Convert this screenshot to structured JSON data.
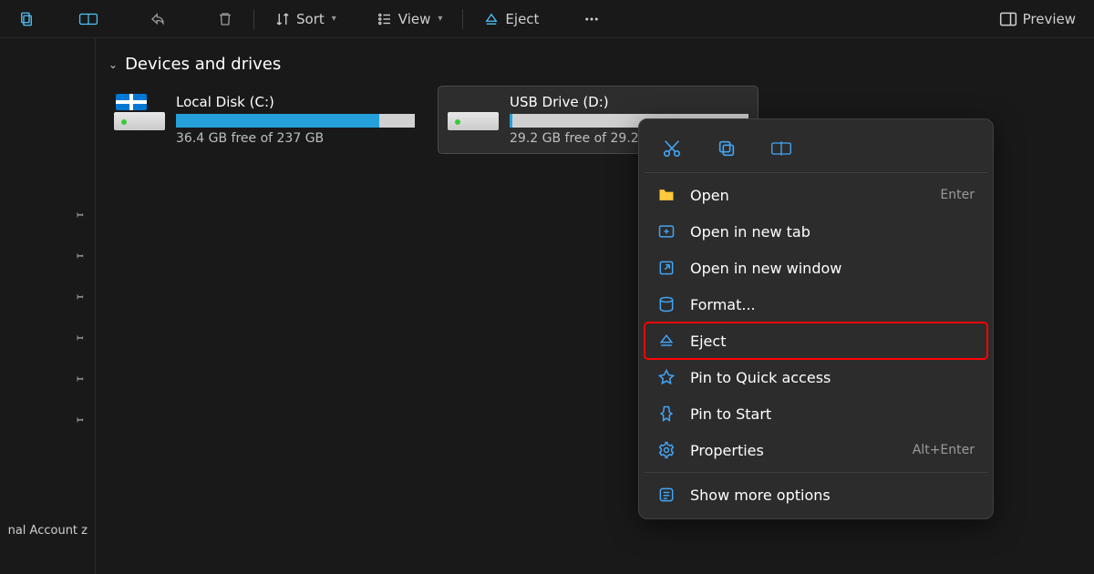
{
  "toolbar": {
    "sort_label": "Sort",
    "view_label": "View",
    "eject_label": "Eject",
    "preview_label": "Preview"
  },
  "section_header": "Devices and drives",
  "drives": [
    {
      "title": "Local Disk (C:)",
      "sub": "36.4 GB free of 237 GB",
      "use_pct": 85,
      "selected": false,
      "icon": "local"
    },
    {
      "title": "USB Drive (D:)",
      "sub": "29.2 GB free of 29.2",
      "use_pct": 1,
      "selected": true,
      "icon": "usb"
    }
  ],
  "context_menu": {
    "open": "Open",
    "open_shortcut": "Enter",
    "open_tab": "Open in new tab",
    "open_win": "Open in new window",
    "format": "Format...",
    "eject": "Eject",
    "pin_quick": "Pin to Quick access",
    "pin_start": "Pin to Start",
    "properties": "Properties",
    "properties_shortcut": "Alt+Enter",
    "more": "Show more options"
  },
  "sidebar_bottom": "nal Account z"
}
